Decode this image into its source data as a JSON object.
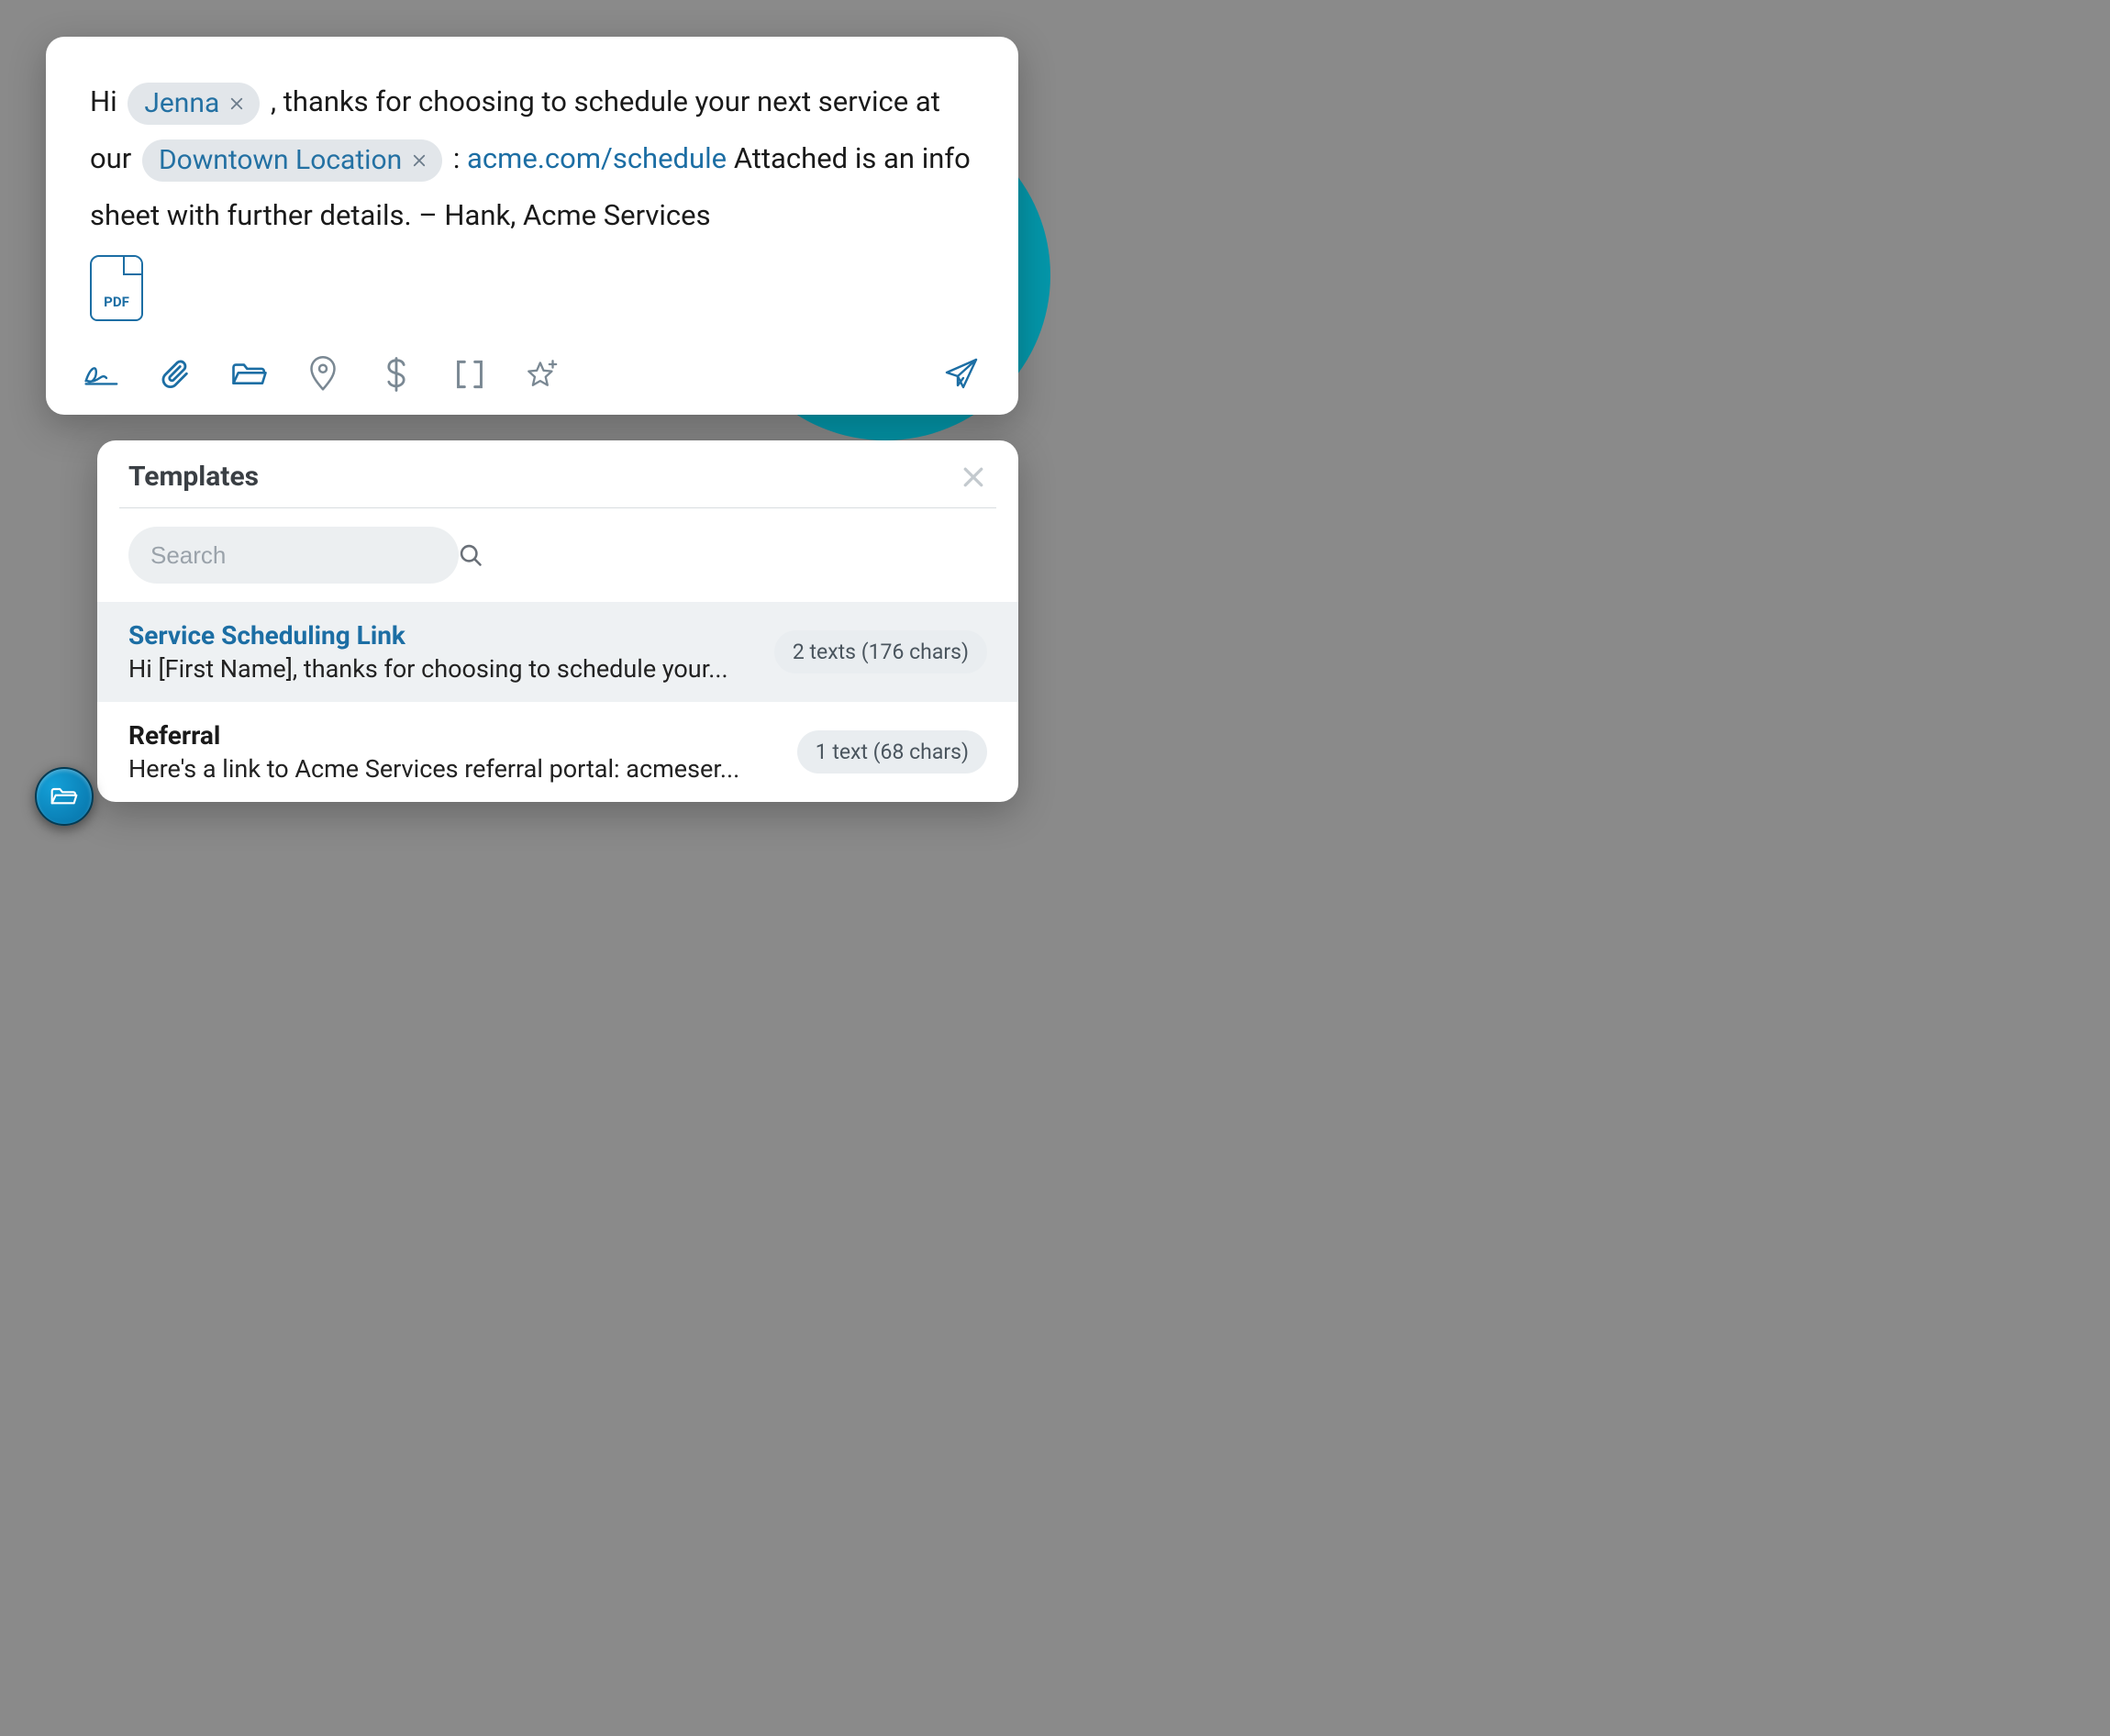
{
  "composer": {
    "text_segments": {
      "s1": "Hi ",
      "chip1": "Jenna",
      "s2": ", thanks for choosing to schedule your next service at our ",
      "chip2": "Downtown Location",
      "s3": " : ",
      "link": "acme.com/schedule",
      "s4": " Attached is an info sheet with further details. – Hank, Acme Services"
    },
    "attachment_label": "PDF"
  },
  "toolbar_icons": {
    "signature": "signature-icon",
    "attach": "paperclip-icon",
    "templates": "folder-open-icon",
    "location": "location-pin-icon",
    "payment": "dollar-icon",
    "placeholder": "brackets-icon",
    "star": "star-plus-icon",
    "send": "paper-plane-icon"
  },
  "templates": {
    "title": "Templates",
    "search_placeholder": "Search",
    "items": [
      {
        "title": "Service Scheduling Link",
        "snippet": "Hi [First Name], thanks for choosing to schedule your...",
        "badge": "2 texts (176 chars)",
        "selected": true
      },
      {
        "title": "Referral",
        "snippet": "Here's a link to Acme Services referral portal: acmeser...",
        "badge": "1 text (68 chars)",
        "selected": false
      }
    ]
  }
}
